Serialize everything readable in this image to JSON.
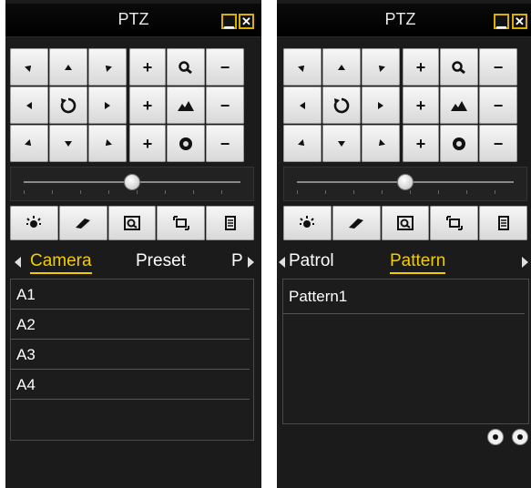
{
  "left": {
    "title": "PTZ",
    "tabs": [
      {
        "label": "Camera",
        "active": true
      },
      {
        "label": "Preset",
        "active": false
      },
      {
        "label": "P",
        "active": false
      }
    ],
    "items": [
      "A1",
      "A2",
      "A3",
      "A4"
    ],
    "speed_level": 0.5
  },
  "right": {
    "title": "PTZ",
    "tabs": [
      {
        "label": "Patrol",
        "active": false
      },
      {
        "label": "Pattern",
        "active": true
      }
    ],
    "items": [
      "Pattern1"
    ],
    "speed_level": 0.5
  },
  "icons": {
    "minimize": "minimize-icon",
    "close": "close-icon",
    "zoom": "zoom-icon",
    "focus": "focus-icon",
    "iris": "iris-icon",
    "auto": "auto-rotate-icon",
    "light": "light-icon",
    "wiper": "wiper-icon",
    "one_touch_focus": "one-touch-focus-icon",
    "lens_init": "lens-init-icon",
    "menu": "menu-icon"
  },
  "colors": {
    "accent": "#f2cc00",
    "panel_bg": "#1b1b1b"
  },
  "glyphs": {
    "plus": "+",
    "minus": "−",
    "minimize": "▁",
    "close": "✕"
  }
}
